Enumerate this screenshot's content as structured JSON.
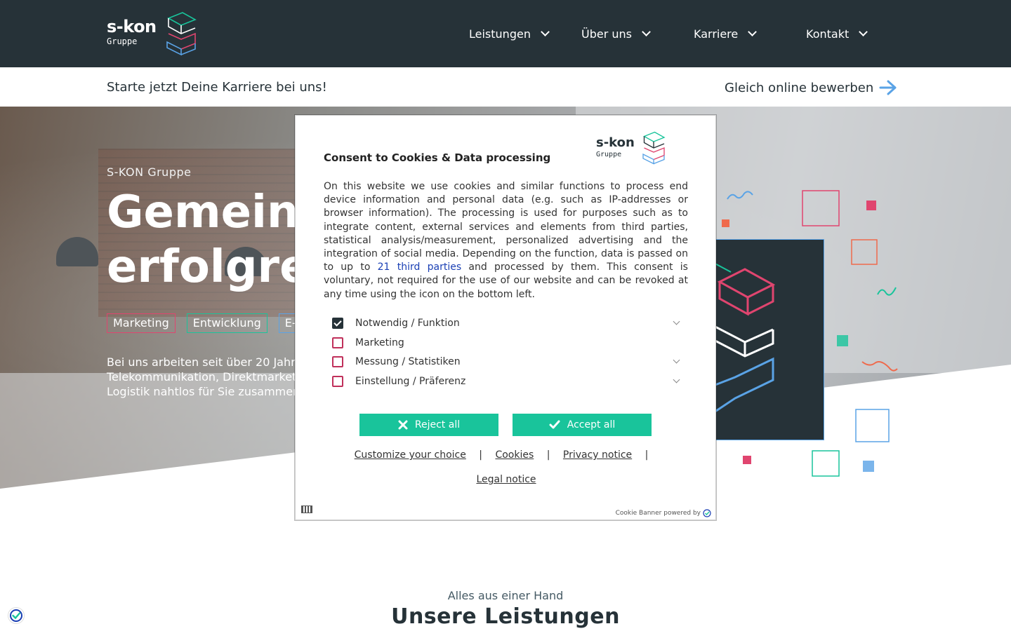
{
  "header": {
    "logo_word": "s-kon",
    "logo_sub": "Gruppe",
    "nav": [
      {
        "label": "Leistungen"
      },
      {
        "label": "Über uns"
      },
      {
        "label": "Karriere"
      },
      {
        "label": "Kontakt"
      }
    ]
  },
  "career_banner": {
    "text": "Starte jetzt Deine Karriere bei uns!",
    "cta": "Gleich online bewerben"
  },
  "hero": {
    "eyebrow": "S-KON Gruppe",
    "title_line1": "Gemein",
    "title_line2": "erfolgre",
    "tags": [
      {
        "label": "Marketing",
        "color": "#e0456f"
      },
      {
        "label": "Entwicklung",
        "color": "#19c49b"
      },
      {
        "label": "E-",
        "color": "#5aa3e6"
      }
    ],
    "text_line1": "Bei uns arbeiten seit über 20 Jahr",
    "text_line2": "Telekommunikation, Direktmarket",
    "text_line3": "Logistik nahtlos für Sie zusammer"
  },
  "section": {
    "eyebrow": "Alles aus einer Hand",
    "title": "Unsere Leistungen"
  },
  "consent": {
    "logo_word": "s-kon",
    "logo_sub": "Gruppe",
    "title": "Consent to Cookies & Data processing",
    "body_before_link": "On this website we use cookies and similar functions to process end device information and personal data (e.g. such as IP-addresses or browser information). The processing is used for purposes such as to integrate content, external services and elements from third parties, statistical analysis/measurement, personalized advertising and the integration of social media. Depending on the function, data is passed on to up to ",
    "body_link": "21 third parties",
    "body_after_link": " and processed by them. This consent is voluntary, not required for the use of our website and can be revoked at any time using the icon on the bottom left.",
    "options": [
      {
        "label": "Notwendig / Funktion",
        "checked": true,
        "expandable": true
      },
      {
        "label": "Marketing",
        "checked": false,
        "expandable": false
      },
      {
        "label": "Messung / Statistiken",
        "checked": false,
        "expandable": true
      },
      {
        "label": "Einstellung / Präferenz",
        "checked": false,
        "expandable": true
      }
    ],
    "reject_label": "Reject all",
    "accept_label": "Accept all",
    "links": [
      "Customize your choice",
      "Cookies",
      "Privacy notice"
    ],
    "separator": "|",
    "legal": "Legal notice",
    "powered_by": "Cookie Banner powered by",
    "accent_color": "#19c49b"
  },
  "colors": {
    "dark": "#263238",
    "pink": "#e0456f",
    "green": "#19c49b",
    "blue": "#5aa3e6",
    "orange": "#ef6a4c"
  }
}
